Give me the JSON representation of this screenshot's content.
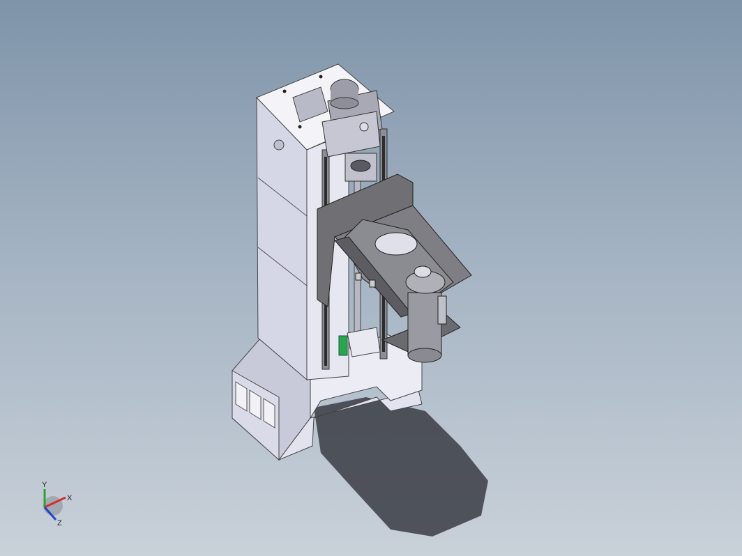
{
  "viewport": {
    "background_top": "#7f94a9",
    "background_bottom": "#c9d1d9"
  },
  "model": {
    "component": "vertical-column-assembly",
    "part_color": "#d9dae8",
    "bracket_color": "#707070",
    "motor_color": "#9a9a9a",
    "shadow_color": "#3a3c44",
    "highlight_color": "#2aa64a"
  },
  "triad": {
    "x_label": "X",
    "y_label": "Y",
    "z_label": "Z",
    "x_color": "#d03030",
    "y_color": "#30a030",
    "z_color": "#2040d0"
  }
}
